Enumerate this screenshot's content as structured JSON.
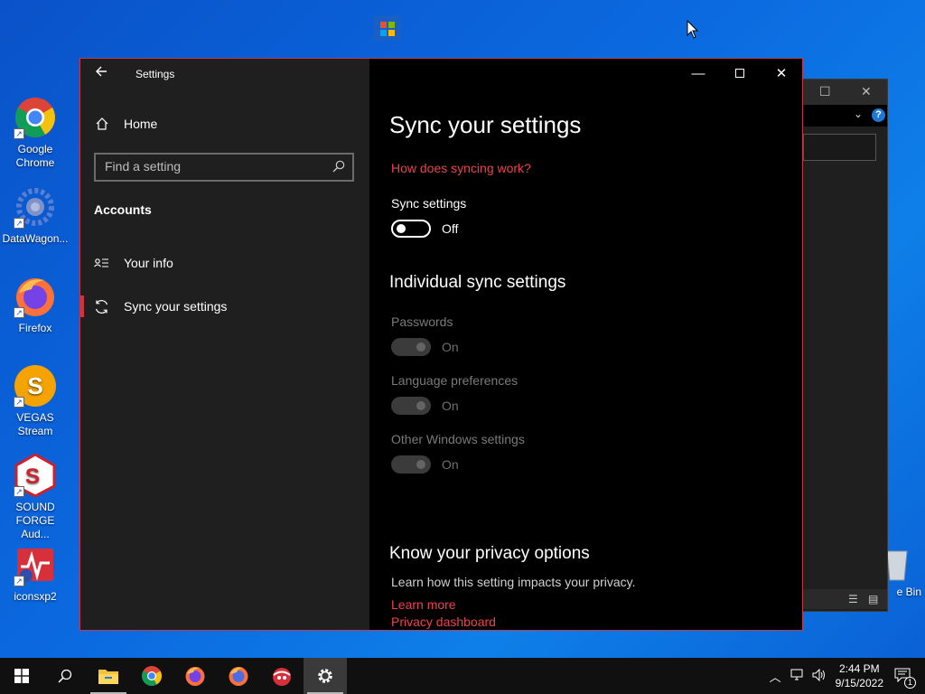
{
  "desktop": {
    "icons": [
      {
        "label": "Google\nChrome",
        "icon": "chrome-icon"
      },
      {
        "label": "DataWagon...",
        "icon": "datawagon-icon"
      },
      {
        "label": "Firefox",
        "icon": "firefox-icon"
      },
      {
        "label": "VEGAS\nStream",
        "icon": "vegas-icon"
      },
      {
        "label": "SOUND\nFORGE Aud...",
        "icon": "soundforge-icon"
      },
      {
        "label": "iconsxp2",
        "icon": "iconsxp-icon"
      }
    ],
    "top_icon_label": "Microsoft Store",
    "recycle_label": "e Bin"
  },
  "window": {
    "app_title": "Settings",
    "nav_home": "Home",
    "search_placeholder": "Find a setting",
    "section": "Accounts",
    "nav_items": [
      {
        "label": "Your info",
        "icon": "person-list-icon"
      },
      {
        "label": "Sync your settings",
        "icon": "sync-icon",
        "active": true
      }
    ]
  },
  "main": {
    "title": "Sync your settings",
    "how_link": "How does syncing work?",
    "sync_label": "Sync settings",
    "sync_state": "Off",
    "individual_title": "Individual sync settings",
    "individual": [
      {
        "label": "Passwords",
        "state": "On"
      },
      {
        "label": "Language preferences",
        "state": "On"
      },
      {
        "label": "Other Windows settings",
        "state": "On"
      }
    ],
    "privacy_title": "Know your privacy options",
    "privacy_text": "Learn how this setting impacts your privacy.",
    "learn_more": "Learn more",
    "privacy_dashboard": "Privacy dashboard"
  },
  "taskbar": {
    "time": "2:44 PM",
    "date": "9/15/2022",
    "notification_count": "1"
  },
  "colors": {
    "accent": "#e8444e",
    "window_border": "#c0394a",
    "sidebar_bg": "#1f1f1f",
    "main_bg": "#000000"
  }
}
